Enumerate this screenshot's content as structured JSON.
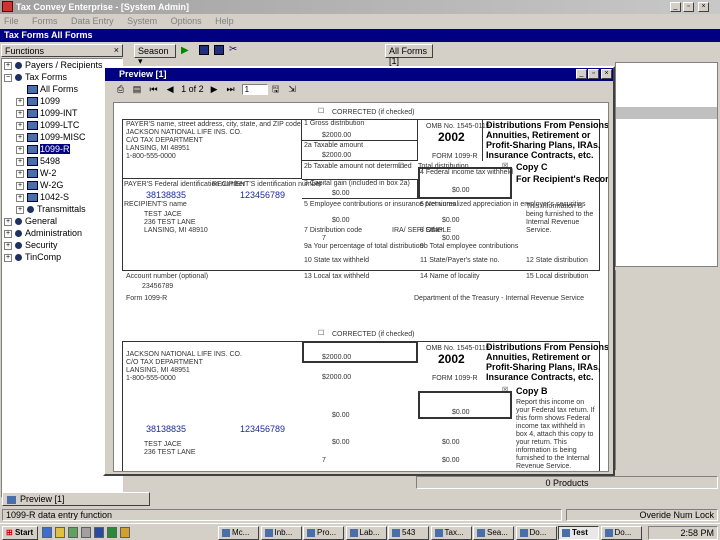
{
  "app": {
    "title": "Tax Convey Enterprise - [System Admin]",
    "menu": [
      "File",
      "Forms",
      "Data Entry",
      "System",
      "Options",
      "Help"
    ],
    "doc_title": "Tax Forms All Forms",
    "window_buttons": [
      "_",
      "▫",
      "×"
    ]
  },
  "functions_panel": {
    "title": "Functions",
    "close": "×",
    "tree": [
      {
        "label": "Payers / Recipients",
        "kind": "dot",
        "level": 0,
        "exp": "+"
      },
      {
        "label": "Tax Forms",
        "kind": "dot",
        "level": 0,
        "exp": "−"
      },
      {
        "label": "All Forms",
        "kind": "doc",
        "level": 1,
        "exp": ""
      },
      {
        "label": "1099",
        "kind": "doc",
        "level": 1,
        "exp": "+"
      },
      {
        "label": "1099-INT",
        "kind": "doc",
        "level": 1,
        "exp": "+"
      },
      {
        "label": "1099-LTC",
        "kind": "doc",
        "level": 1,
        "exp": "+"
      },
      {
        "label": "1099-MISC",
        "kind": "doc",
        "level": 1,
        "exp": "+"
      },
      {
        "label": "1099-R",
        "kind": "doc",
        "level": 1,
        "exp": "+",
        "selected": true
      },
      {
        "label": "5498",
        "kind": "doc",
        "level": 1,
        "exp": "+"
      },
      {
        "label": "W-2",
        "kind": "doc",
        "level": 1,
        "exp": "+"
      },
      {
        "label": "W-2G",
        "kind": "doc",
        "level": 1,
        "exp": "+"
      },
      {
        "label": "1042-S",
        "kind": "doc",
        "level": 1,
        "exp": "+"
      },
      {
        "label": "Transmittals",
        "kind": "dot",
        "level": 1,
        "exp": "+"
      },
      {
        "label": "General",
        "kind": "dot",
        "level": 0,
        "exp": "+"
      },
      {
        "label": "Administration",
        "kind": "dot",
        "level": 0,
        "exp": "+"
      },
      {
        "label": "Security",
        "kind": "dot",
        "level": 0,
        "exp": "+"
      },
      {
        "label": "TinComp",
        "kind": "dot",
        "level": 0,
        "exp": "+"
      }
    ]
  },
  "main_toolbar": {
    "season_label": "Season",
    "all_forms_tab": "All Forms [1]"
  },
  "preview": {
    "title": "Preview [1]",
    "page_indicator": "1 of 2",
    "page_input": "1",
    "close_buttons": [
      "_",
      "▫",
      "×"
    ]
  },
  "form_copy_c": {
    "corrected": "CORRECTED (if checked)",
    "payer_label": "PAYER'S name, street address, city, state, and ZIP code",
    "payer_lines": [
      "JACKSON NATIONAL LIFE INS. CO.",
      "C/O TAX DEPARTMENT",
      "LANSING, MI 48951",
      "1-800-555-0000"
    ],
    "omb": "OMB No. 1545-0119",
    "year": "2002",
    "form_name": "FORM 1099-R",
    "title_lines": [
      "Distributions From Pensions,",
      "Annuities, Retirement or",
      "Profit-Sharing Plans, IRAs,",
      "Insurance Contracts, etc."
    ],
    "box1": "1 Gross distribution",
    "box1_val": "$2000.00",
    "box2a": "2a Taxable amount",
    "box2a_val": "$2000.00",
    "box2b": "2b Taxable amount not determined",
    "total_dist": "Total distribution",
    "copy_label": "Copy C",
    "copy_sub": "For Recipient's Records",
    "payer_tin_label": "PAYER'S Federal identification number",
    "recipient_tin_label": "RECIPIENT'S identification number",
    "payer_tin": "38138835",
    "recipient_tin": "123456789",
    "box3": "3 Capital gain (included in box 2a)",
    "box3_val": "$0.00",
    "box4": "4 Federal income tax withheld",
    "box4_val": "$0.00",
    "recipient_name_label": "RECIPIENT'S name",
    "recipient_lines": [
      "TEST JACE",
      "236 TEST LANE",
      "LANSING, MI 48910"
    ],
    "box5": "5 Employee contributions or insurance premiums",
    "box5_val": "$0.00",
    "box6": "6 Net unrealized appreciation in employer's securities",
    "box6_val": "$0.00",
    "box7": "7 Distribution code",
    "box7_val": "7",
    "ira": "IRA/ SEP/ SIMPLE",
    "box8": "8 Other",
    "box8_val": "$0.00",
    "box9a": "9a Your percentage of total distribution",
    "box9b": "9b Total employee contributions",
    "box10": "10 State tax withheld",
    "box11": "11 State/Payer's state no.",
    "box12": "12 State distribution",
    "box13": "13 Local tax withheld",
    "box14": "14 Name of locality",
    "box15": "15 Local distribution",
    "account_label": "Account number (optional)",
    "account_val": "23456789",
    "footer_left": "Form 1099-R",
    "footer_right": "Department of the Treasury - Internal Revenue Service",
    "copy_note": "This information is being furnished to the Internal Revenue Service."
  },
  "form_copy_b": {
    "corrected": "CORRECTED (if checked)",
    "payer_lines": [
      "JACKSON NATIONAL LIFE INS. CO.",
      "C/O TAX DEPARTMENT",
      "LANSING, MI 48951",
      "1-800-555-0000"
    ],
    "omb": "OMB No. 1545-0119",
    "year": "2002",
    "form_name": "FORM 1099-R",
    "title_lines": [
      "Distributions From Pensions,",
      "Annuities, Retirement or",
      "Profit-Sharing Plans, IRAs,",
      "Insurance Contracts, etc."
    ],
    "box1_val": "$2000.00",
    "box2a_val": "$2000.00",
    "copy_label": "Copy B",
    "copy_note": "Report this income on your Federal tax return. If this form shows Federal income tax withheld in box 4, attach this copy to your return. This information is being furnished to the Internal Revenue Service.",
    "payer_tin": "38138835",
    "recipient_tin": "123456789",
    "box3_val": "$0.00",
    "box4_val": "$0.00",
    "recipient_lines": [
      "TEST JACE",
      "236 TEST LANE"
    ],
    "box5_val": "$0.00",
    "box6_val": "$0.00",
    "box7_val": "7",
    "box8_val": "$0.00"
  },
  "right_panel": {
    "footer": "0 Products"
  },
  "bottom_tabs": {
    "preview_tab": "Preview [1]"
  },
  "status": {
    "left": "1099-R data entry function",
    "right": "Overide  Num Lock"
  },
  "taskbar": {
    "start": "Start",
    "buttons": [
      "Mc...",
      "Inb...",
      "Pro...",
      "Lab...",
      "543",
      "Tax...",
      "Sea...",
      "Do...",
      "Test",
      "Do..."
    ],
    "active_index": 8,
    "clock": "2:58 PM"
  },
  "colors": {
    "titlebar": "#000080",
    "face": "#d4d0c8",
    "form_title": "#000",
    "tin_blue": "#1a2a9a"
  }
}
